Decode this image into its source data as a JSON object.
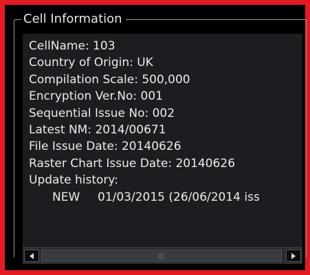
{
  "group": {
    "title": "Cell Information"
  },
  "cell_info": {
    "cell_name": "CellName: 103",
    "country": "Country of Origin: UK",
    "scale": "Compilation Scale: 500,000",
    "encryption": "Encryption Ver.No: 001",
    "sequential_issue": "Sequential Issue No: 002",
    "latest_nm": "Latest NM: 2014/00671",
    "file_issue_date": "File Issue Date: 20140626",
    "raster_issue_date": "Raster Chart Issue Date: 20140626",
    "update_history_label": "Update history:",
    "history": [
      {
        "type": "NEW",
        "detail": "01/03/2015 (26/06/2014 iss"
      }
    ]
  },
  "scrollbar": {
    "orientation": "horizontal",
    "left_icon": "triangle-left-icon",
    "right_icon": "triangle-right-icon"
  }
}
